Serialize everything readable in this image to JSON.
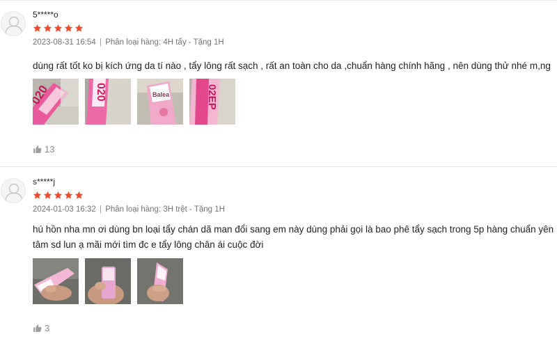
{
  "reviews": [
    {
      "username": "5*****o",
      "rating": 5,
      "timestamp": "2023-08-31 16:54",
      "variant": "Phân loại hàng: 4H tẩy - Tặng 1H",
      "comment": "dùng rất tốt ko bị kích ứng da tí nào , tẩy lông rất sạch , rất an toàn cho da ,chuẩn hàng chính hãng , nên dùng thử nhé m,ng",
      "likes": "13"
    },
    {
      "username": "s*****j",
      "rating": 5,
      "timestamp": "2024-01-03 16:32",
      "variant": "Phân loại hàng: 3H trệt - Tặng 1H",
      "comment": "hú hồn nha mn ơi dùng bn loại tẩy chán dã man đổi sang em này dùng phải gọi là  bao phê tẩy sạch trong 5p  hàng chuẩn yên tâm sd lun ạ mãi mới tìm đc e tẩy lông chân ái cuộc đời",
      "likes": "3"
    }
  ],
  "colors": {
    "star": "#ee4d2d",
    "meta_text": "#757575",
    "like_text": "#8a8a8a"
  },
  "icons": {
    "avatar": "user-placeholder-icon",
    "star": "star-icon",
    "like": "thumbs-up-icon"
  }
}
